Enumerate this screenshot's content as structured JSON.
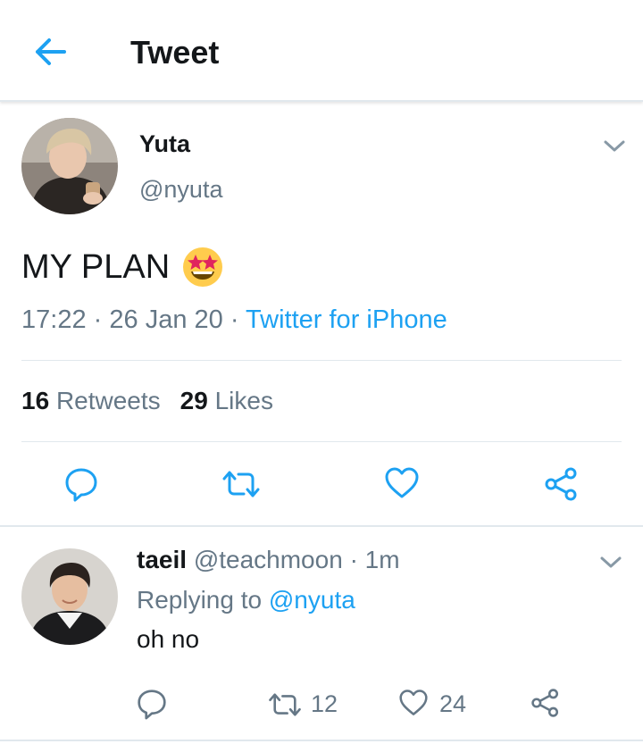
{
  "header": {
    "title": "Tweet"
  },
  "tweet": {
    "author_name": "Yuta",
    "author_handle": "@nyuta",
    "text": "MY PLAN",
    "emoji": "star-struck-emoji",
    "time": "17:22",
    "date": "26 Jan 20",
    "source": "Twitter for iPhone",
    "separator": "·",
    "retweets_count": "16",
    "retweets_label": "Retweets",
    "likes_count": "29",
    "likes_label": "Likes"
  },
  "reply": {
    "author_name": "taeil",
    "author_handle": "@teachmoon",
    "time_ago": "1m",
    "replying_prefix": "Replying to",
    "replying_to": "@nyuta",
    "text": "oh no",
    "retweets": "12",
    "likes": "24"
  },
  "colors": {
    "accent": "#1da1f2",
    "muted": "#657786",
    "divider": "#e1e8ed"
  },
  "icons": [
    "back-arrow-icon",
    "chevron-down-icon",
    "reply-icon",
    "retweet-icon",
    "heart-icon",
    "share-icon"
  ]
}
